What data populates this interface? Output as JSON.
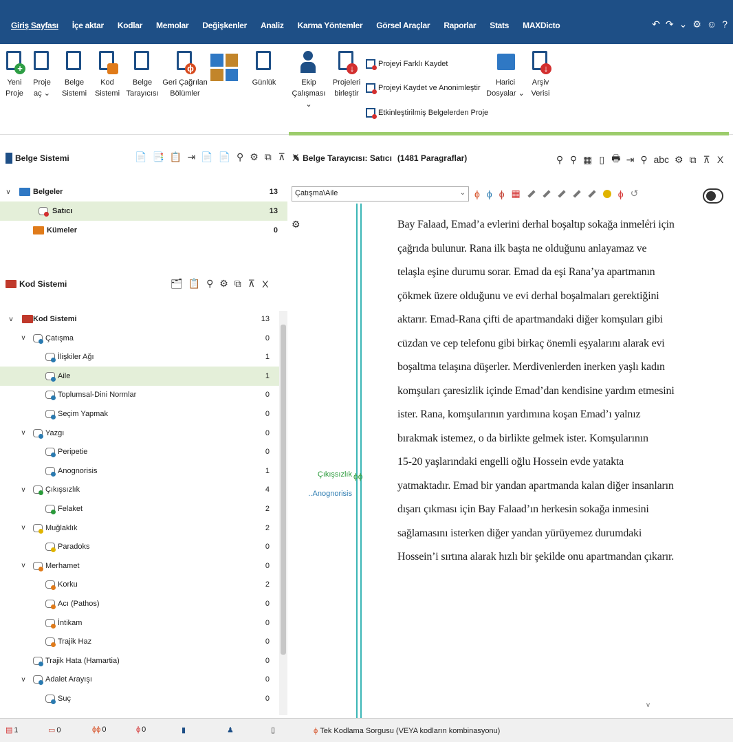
{
  "menubar": {
    "tabs": [
      "Giriş Sayfası",
      "İçe aktar",
      "Kodlar",
      "Memolar",
      "Değişkenler",
      "Analiz",
      "Karma Yöntemler",
      "Görsel Araçlar",
      "Raporlar",
      "Stats",
      "MAXDicto"
    ],
    "active_tab": "Giriş Sayfası",
    "quick_access": [
      "↶",
      "↷",
      "⌄",
      "⚙",
      "☺",
      "?"
    ]
  },
  "ribbon": {
    "new_project": [
      "Yeni",
      "Proje"
    ],
    "open_project": [
      "Proje",
      "aç ⌄"
    ],
    "document_system": [
      "Belge",
      "Sistemi"
    ],
    "code_system": [
      "Kod",
      "Sistemi"
    ],
    "document_browser": [
      "Belge",
      "Tarayıcısı"
    ],
    "retrieved_segments": [
      "Geri Çağrılan",
      "Bölümler"
    ],
    "logbook": "Günlük",
    "teamwork": [
      "Ekip",
      "Çalışması ⌄"
    ],
    "merge_projects": [
      "Projeleri",
      "birleştir"
    ],
    "save_as": "Projeyi Farklı Kaydet",
    "save_anonymize": "Projeyi Kaydet ve Anonimleştir",
    "from_activated": "Etkinleştirilmiş Belgelerden Proje",
    "external_files": [
      "Harici",
      "Dosyalar ⌄"
    ],
    "archive_data": [
      "Arşiv",
      "Verisi"
    ]
  },
  "document_system": {
    "title": "Belge Sistemi",
    "header_icons": [
      "📄",
      "📑",
      "📋",
      "⇥",
      "📄",
      "📄",
      "⚲",
      "⚙",
      "⧉",
      "⊼",
      "X"
    ],
    "rows": [
      {
        "label": "Belgeler",
        "count": "13",
        "toggle": "v"
      },
      {
        "label": "Satıcı",
        "count": "13"
      },
      {
        "label": "Kümeler",
        "count": "0"
      }
    ]
  },
  "code_system": {
    "title": "Kod Sistemi",
    "header_icons": [
      "🗂",
      "📋",
      "⚲",
      "⚙",
      "⧉",
      "⊼",
      "X"
    ],
    "rows": [
      {
        "label": "Kod Sistemi",
        "count": "13",
        "toggle": "v"
      },
      {
        "label": "Çatışma",
        "count": "0",
        "toggle": "v"
      },
      {
        "label": "İlişkiler Ağı",
        "count": "1"
      },
      {
        "label": "Aile",
        "count": "1"
      },
      {
        "label": "Toplumsal-Dini Normlar",
        "count": "0"
      },
      {
        "label": "Seçim Yapmak",
        "count": "0"
      },
      {
        "label": "Yazgı",
        "count": "0",
        "toggle": "v"
      },
      {
        "label": "Peripetie",
        "count": "0"
      },
      {
        "label": "Anognorisis",
        "count": "1"
      },
      {
        "label": "Çıkışsızlık",
        "count": "4",
        "toggle": "v"
      },
      {
        "label": "Felaket",
        "count": "2"
      },
      {
        "label": "Muğlaklık",
        "count": "2",
        "toggle": "v"
      },
      {
        "label": "Paradoks",
        "count": "0"
      },
      {
        "label": "Merhamet",
        "count": "0",
        "toggle": "v"
      },
      {
        "label": "Korku",
        "count": "2"
      },
      {
        "label": "Acı (Pathos)",
        "count": "0"
      },
      {
        "label": "İntikam",
        "count": "0"
      },
      {
        "label": "Trajik Haz",
        "count": "0"
      },
      {
        "label": "Trajik Hata (Hamartia)",
        "count": "0"
      },
      {
        "label": "Adalet Arayışı",
        "count": "0",
        "toggle": "v"
      },
      {
        "label": "Suç",
        "count": "0"
      }
    ]
  },
  "document_browser": {
    "title": "Belge Tarayıcısı: Satıcı",
    "paragraph_count": "(1481 Paragraflar)",
    "header_icons": [
      "⚲",
      "⚲",
      "▦",
      "▯",
      "🖶",
      "⇥",
      "⚲",
      "abc",
      "⚙",
      "⧉",
      "⊼",
      "X"
    ],
    "code_filter": "Çatışma\\Aile",
    "code_marks": [
      "Çıkışsızlık",
      "..Anognorisis"
    ],
    "lines": [
      "Bay Falaad, Emad’a evlerini derhal boşaltıp sokağa inmeleri için",
      "çağrıda bulunur. Rana ilk başta ne olduğunu anlayamaz ve",
      "telaşla eşine durumu sorar. Emad da eşi Rana’ya apartmanın",
      "çökmek üzere olduğunu ve evi derhal boşalmaları gerektiğini",
      "aktarır. Emad-Rana çifti de apartmandaki diğer komşuları gibi",
      "cüzdan ve cep telefonu gibi birkaç önemli eşyalarını alarak evi",
      "boşaltma telaşına düşerler. Merdivenlerden inerken yaşlı kadın",
      "komşuları çaresizlik içinde Emad’dan kendisine yardım etmesini",
      "ister. Rana, komşularının yardımına koşan Emad’ı yalnız",
      "bırakmak istemez, o da birlikte gelmek ister. Komşularının",
      "15-20 yaşlarındaki engelli oğlu Hossein evde yatakta",
      "yatmaktadır. Emad bir yandan apartmanda kalan diğer insanların",
      "dışarı çıkması için Bay Falaad’ın herkesin sokağa inmesini",
      "sağlamasını isterken diğer yandan yürüyemez durumdaki",
      "Hossein’i sırtına alarak hızlı bir şekilde onu apartmandan çıkarır."
    ]
  },
  "statusbar": {
    "items": [
      "1",
      "0",
      "0",
      "0",
      "",
      ""
    ],
    "query": "Tek Kodlama Sorgusu (VEYA kodların kombinasyonu)"
  },
  "colors": {
    "menubar": "#1e4f86",
    "selection": "#e4efd9",
    "accent_green": "#9ccc6b",
    "stripe": "#3bb6b6"
  }
}
